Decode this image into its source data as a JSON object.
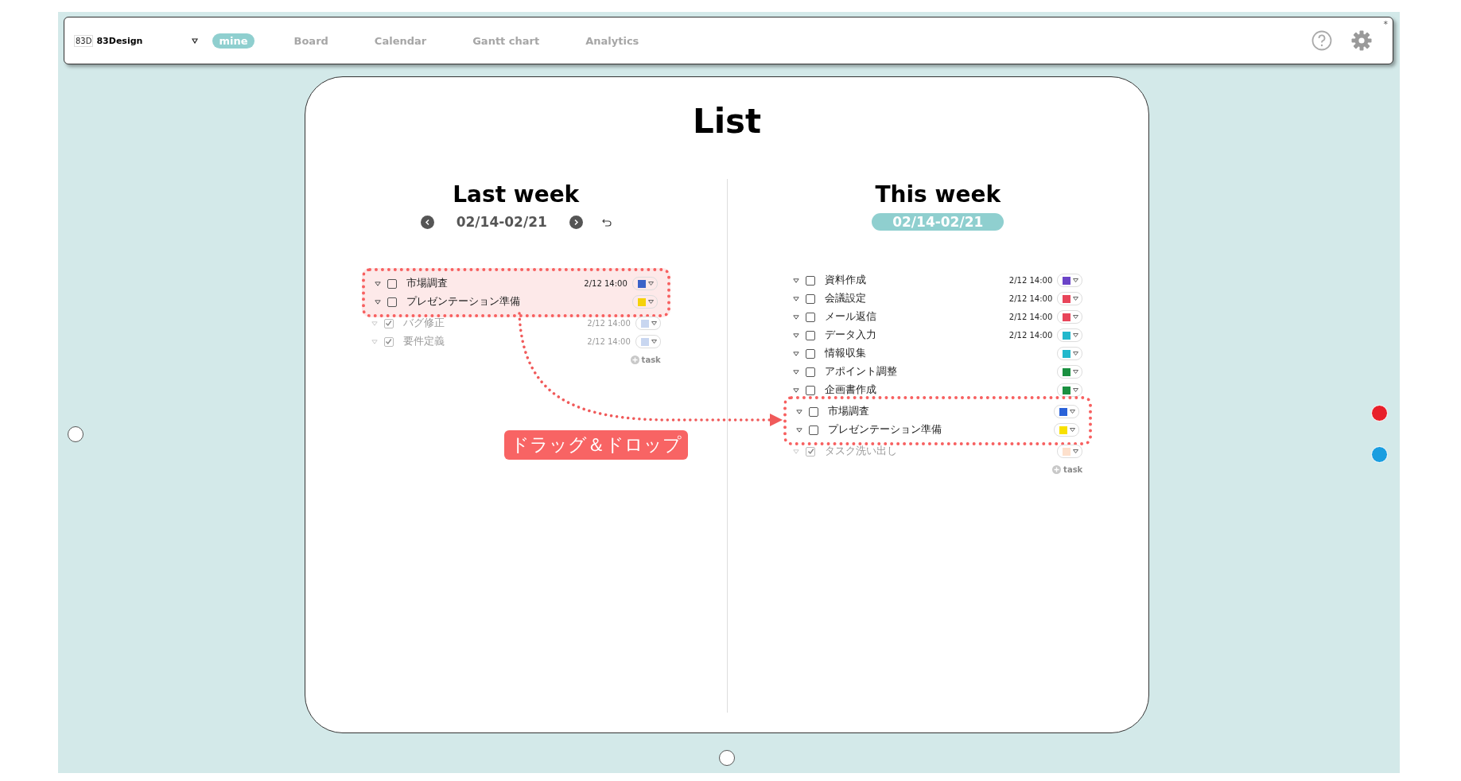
{
  "topbar": {
    "logo_text": "83D",
    "brand": "83Design",
    "corner_mark": "*",
    "tabs": [
      {
        "label": "mine",
        "selected": true
      },
      {
        "label": "Board",
        "selected": false
      },
      {
        "label": "Calendar",
        "selected": false
      },
      {
        "label": "Gantt chart",
        "selected": false
      },
      {
        "label": "Analytics",
        "selected": false
      }
    ]
  },
  "title": "List",
  "columns": [
    {
      "title": "Last week",
      "date_range": "02/14-02/21",
      "kind": "nav",
      "add_label": "task",
      "tasks": [
        {
          "name": "市場調査",
          "date": "2/12  14:00",
          "color": "#3a62c8",
          "checked": false,
          "in_selection": true
        },
        {
          "name": "プレゼンテーション準備",
          "color": "#f5d20a",
          "checked": false,
          "in_selection": true
        },
        {
          "name": "バグ修正",
          "date": "2/12  14:00",
          "color": "#c8d6f0",
          "checked": true,
          "in_selection": false
        },
        {
          "name": "要件定義",
          "date": "2/12  14:00",
          "color": "#c8d6f0",
          "checked": true,
          "in_selection": false
        }
      ]
    },
    {
      "title": "This week",
      "date_range": "02/14-02/21",
      "kind": "current",
      "add_label": "task",
      "tasks": [
        {
          "name": "資料作成",
          "date": "2/12  14:00",
          "color": "#6b44c8",
          "checked": false,
          "in_selection": false
        },
        {
          "name": "会議設定",
          "date": "2/12  14:00",
          "color": "#e8455a",
          "checked": false,
          "in_selection": false
        },
        {
          "name": "メール返信",
          "date": "2/12  14:00",
          "color": "#e8455a",
          "checked": false,
          "in_selection": false
        },
        {
          "name": "データ入力",
          "date": "2/12  14:00",
          "color": "#22b8cc",
          "checked": false,
          "in_selection": false
        },
        {
          "name": "情報収集",
          "color": "#22b8cc",
          "checked": false,
          "in_selection": false
        },
        {
          "name": "アポイント調整",
          "color": "#1a9040",
          "checked": false,
          "in_selection": false
        },
        {
          "name": "企画書作成",
          "color": "#1a9040",
          "checked": false,
          "in_selection": false
        },
        {
          "name": "市場調査",
          "color": "#2a62d8",
          "checked": false,
          "in_selection": true
        },
        {
          "name": "プレゼンテーション準備",
          "color": "#f8e000",
          "checked": false,
          "in_selection": true
        },
        {
          "name": "タスク洗い出し",
          "color": "#fde0cc",
          "checked": true,
          "in_selection": false
        }
      ]
    }
  ],
  "drag_label": "ドラッグ＆ドロップ",
  "side_dots": [
    {
      "color": "#e8202a"
    },
    {
      "color": "#1a9ee0"
    }
  ]
}
